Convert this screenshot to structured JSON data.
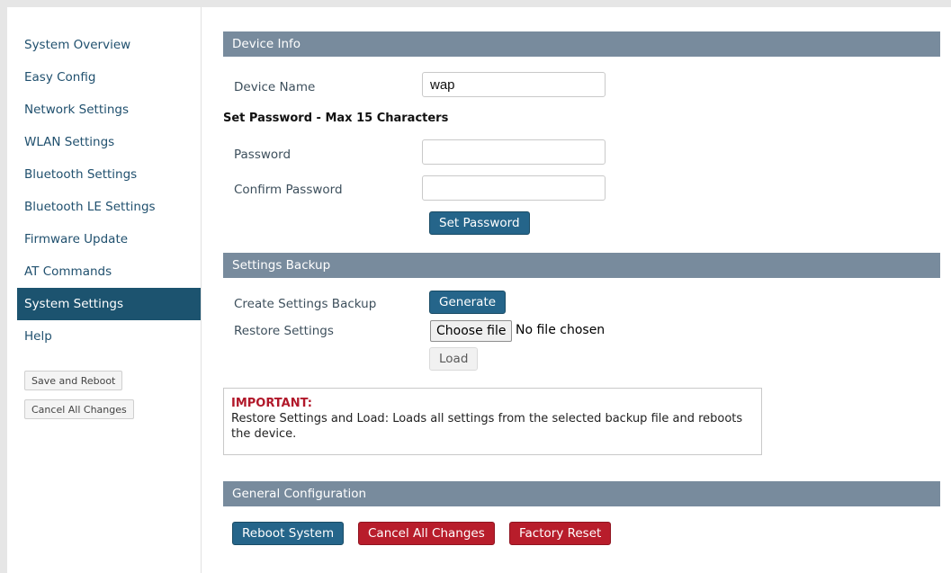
{
  "sidebar": {
    "items": [
      {
        "label": "System Overview"
      },
      {
        "label": "Easy Config"
      },
      {
        "label": "Network Settings"
      },
      {
        "label": "WLAN Settings"
      },
      {
        "label": "Bluetooth Settings"
      },
      {
        "label": "Bluetooth LE Settings"
      },
      {
        "label": "Firmware Update"
      },
      {
        "label": "AT Commands"
      },
      {
        "label": "System Settings",
        "active": true
      },
      {
        "label": "Help"
      }
    ],
    "save_reboot_label": "Save and Reboot",
    "cancel_changes_label": "Cancel All Changes"
  },
  "device_info": {
    "title": "Device Info",
    "device_name_label": "Device Name",
    "device_name_value": "wap",
    "set_password_heading": "Set Password - Max 15 Characters",
    "password_label": "Password",
    "password_value": "",
    "confirm_password_label": "Confirm Password",
    "confirm_password_value": "",
    "set_password_button": "Set Password"
  },
  "settings_backup": {
    "title": "Settings Backup",
    "create_backup_label": "Create Settings Backup",
    "generate_button": "Generate",
    "restore_label": "Restore Settings",
    "choose_file_button": "Choose file",
    "no_file_text": "No file chosen",
    "load_button": "Load"
  },
  "notice": {
    "heading": "IMPORTANT:",
    "body": "Restore Settings and Load: Loads all settings from the selected backup file and reboots the device."
  },
  "general_config": {
    "title": "General Configuration",
    "reboot_button": "Reboot System",
    "cancel_button": "Cancel All Changes",
    "factory_reset_button": "Factory Reset"
  },
  "colors": {
    "sidebar_active": "#1c536f",
    "section_bar": "#788b9d",
    "primary_button": "#25658a",
    "danger_button": "#b81d2b",
    "important_text": "#b1182a"
  }
}
